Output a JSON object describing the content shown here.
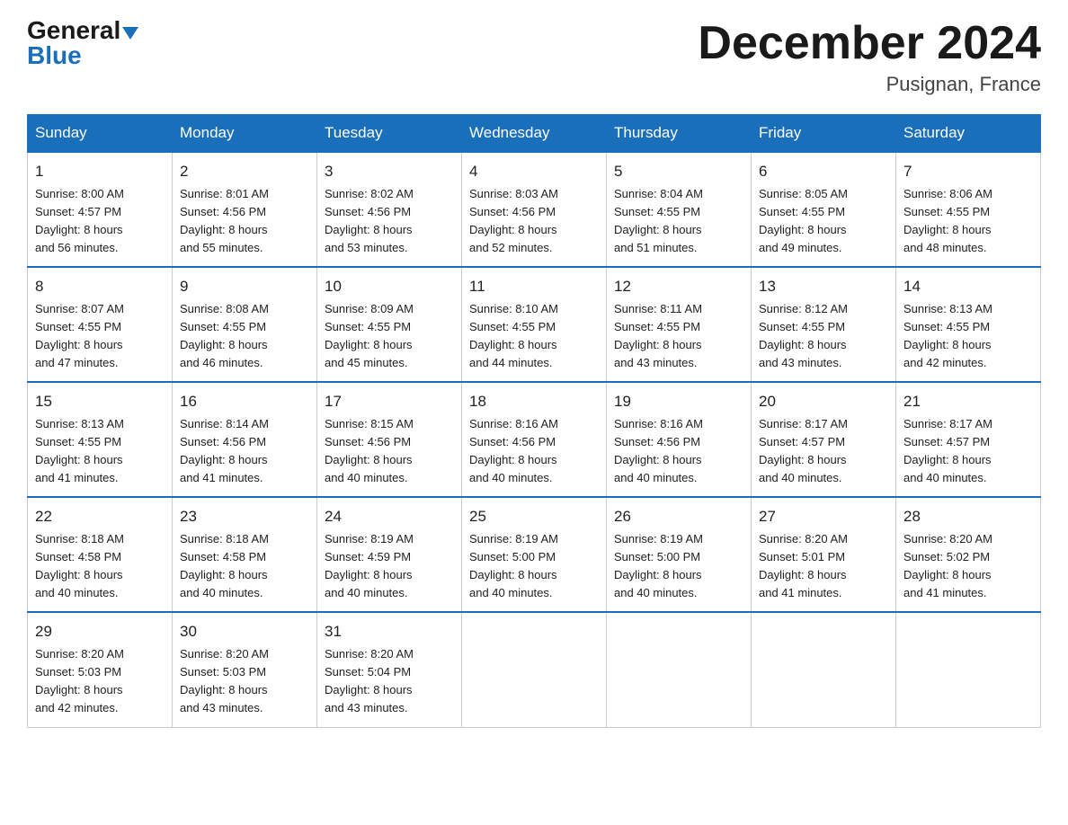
{
  "logo": {
    "general": "General",
    "blue": "Blue"
  },
  "title": "December 2024",
  "subtitle": "Pusignan, France",
  "days_of_week": [
    "Sunday",
    "Monday",
    "Tuesday",
    "Wednesday",
    "Thursday",
    "Friday",
    "Saturday"
  ],
  "weeks": [
    [
      {
        "num": "1",
        "sunrise": "8:00 AM",
        "sunset": "4:57 PM",
        "daylight": "8 hours and 56 minutes."
      },
      {
        "num": "2",
        "sunrise": "8:01 AM",
        "sunset": "4:56 PM",
        "daylight": "8 hours and 55 minutes."
      },
      {
        "num": "3",
        "sunrise": "8:02 AM",
        "sunset": "4:56 PM",
        "daylight": "8 hours and 53 minutes."
      },
      {
        "num": "4",
        "sunrise": "8:03 AM",
        "sunset": "4:56 PM",
        "daylight": "8 hours and 52 minutes."
      },
      {
        "num": "5",
        "sunrise": "8:04 AM",
        "sunset": "4:55 PM",
        "daylight": "8 hours and 51 minutes."
      },
      {
        "num": "6",
        "sunrise": "8:05 AM",
        "sunset": "4:55 PM",
        "daylight": "8 hours and 49 minutes."
      },
      {
        "num": "7",
        "sunrise": "8:06 AM",
        "sunset": "4:55 PM",
        "daylight": "8 hours and 48 minutes."
      }
    ],
    [
      {
        "num": "8",
        "sunrise": "8:07 AM",
        "sunset": "4:55 PM",
        "daylight": "8 hours and 47 minutes."
      },
      {
        "num": "9",
        "sunrise": "8:08 AM",
        "sunset": "4:55 PM",
        "daylight": "8 hours and 46 minutes."
      },
      {
        "num": "10",
        "sunrise": "8:09 AM",
        "sunset": "4:55 PM",
        "daylight": "8 hours and 45 minutes."
      },
      {
        "num": "11",
        "sunrise": "8:10 AM",
        "sunset": "4:55 PM",
        "daylight": "8 hours and 44 minutes."
      },
      {
        "num": "12",
        "sunrise": "8:11 AM",
        "sunset": "4:55 PM",
        "daylight": "8 hours and 43 minutes."
      },
      {
        "num": "13",
        "sunrise": "8:12 AM",
        "sunset": "4:55 PM",
        "daylight": "8 hours and 43 minutes."
      },
      {
        "num": "14",
        "sunrise": "8:13 AM",
        "sunset": "4:55 PM",
        "daylight": "8 hours and 42 minutes."
      }
    ],
    [
      {
        "num": "15",
        "sunrise": "8:13 AM",
        "sunset": "4:55 PM",
        "daylight": "8 hours and 41 minutes."
      },
      {
        "num": "16",
        "sunrise": "8:14 AM",
        "sunset": "4:56 PM",
        "daylight": "8 hours and 41 minutes."
      },
      {
        "num": "17",
        "sunrise": "8:15 AM",
        "sunset": "4:56 PM",
        "daylight": "8 hours and 40 minutes."
      },
      {
        "num": "18",
        "sunrise": "8:16 AM",
        "sunset": "4:56 PM",
        "daylight": "8 hours and 40 minutes."
      },
      {
        "num": "19",
        "sunrise": "8:16 AM",
        "sunset": "4:56 PM",
        "daylight": "8 hours and 40 minutes."
      },
      {
        "num": "20",
        "sunrise": "8:17 AM",
        "sunset": "4:57 PM",
        "daylight": "8 hours and 40 minutes."
      },
      {
        "num": "21",
        "sunrise": "8:17 AM",
        "sunset": "4:57 PM",
        "daylight": "8 hours and 40 minutes."
      }
    ],
    [
      {
        "num": "22",
        "sunrise": "8:18 AM",
        "sunset": "4:58 PM",
        "daylight": "8 hours and 40 minutes."
      },
      {
        "num": "23",
        "sunrise": "8:18 AM",
        "sunset": "4:58 PM",
        "daylight": "8 hours and 40 minutes."
      },
      {
        "num": "24",
        "sunrise": "8:19 AM",
        "sunset": "4:59 PM",
        "daylight": "8 hours and 40 minutes."
      },
      {
        "num": "25",
        "sunrise": "8:19 AM",
        "sunset": "5:00 PM",
        "daylight": "8 hours and 40 minutes."
      },
      {
        "num": "26",
        "sunrise": "8:19 AM",
        "sunset": "5:00 PM",
        "daylight": "8 hours and 40 minutes."
      },
      {
        "num": "27",
        "sunrise": "8:20 AM",
        "sunset": "5:01 PM",
        "daylight": "8 hours and 41 minutes."
      },
      {
        "num": "28",
        "sunrise": "8:20 AM",
        "sunset": "5:02 PM",
        "daylight": "8 hours and 41 minutes."
      }
    ],
    [
      {
        "num": "29",
        "sunrise": "8:20 AM",
        "sunset": "5:03 PM",
        "daylight": "8 hours and 42 minutes."
      },
      {
        "num": "30",
        "sunrise": "8:20 AM",
        "sunset": "5:03 PM",
        "daylight": "8 hours and 43 minutes."
      },
      {
        "num": "31",
        "sunrise": "8:20 AM",
        "sunset": "5:04 PM",
        "daylight": "8 hours and 43 minutes."
      },
      null,
      null,
      null,
      null
    ]
  ],
  "labels": {
    "sunrise": "Sunrise:",
    "sunset": "Sunset:",
    "daylight": "Daylight:"
  }
}
